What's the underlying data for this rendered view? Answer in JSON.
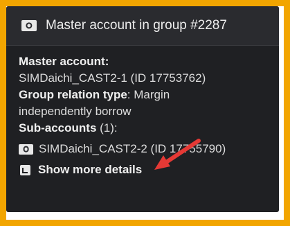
{
  "header": {
    "icon": "account-icon",
    "title": "Master account in group #2287"
  },
  "master": {
    "label": "Master account:",
    "value": "SIMDaichi_CAST2-1 (ID 17753762)"
  },
  "relation": {
    "label": "Group relation type",
    "value": ": Margin independently borrow",
    "value_line1": ": Margin",
    "value_line2": "independently borrow"
  },
  "subaccounts": {
    "label": "Sub-accounts",
    "count": " (1):",
    "items": [
      {
        "icon": "account-icon",
        "text": "SIMDaichi_CAST2-2 (ID 17755790)"
      }
    ]
  },
  "more": {
    "icon": "expand-icon",
    "label": "Show more details"
  },
  "colors": {
    "frame": "#f2a500",
    "panel": "#1f2023",
    "header": "#2a2b2f",
    "arrow": "#e53935"
  }
}
